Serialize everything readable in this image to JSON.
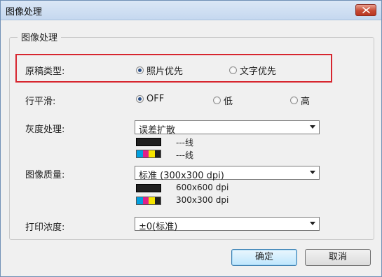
{
  "window": {
    "title": "图像处理",
    "close_icon": "close-icon"
  },
  "group": {
    "label": "图像处理"
  },
  "original_type": {
    "label": "原稿类型:",
    "options": [
      {
        "label": "照片优先",
        "checked": true
      },
      {
        "label": "文字优先",
        "checked": false
      }
    ]
  },
  "smoothing": {
    "label": "行平滑:",
    "options": [
      {
        "label": "OFF",
        "checked": true
      },
      {
        "label": "低",
        "checked": false
      },
      {
        "label": "高",
        "checked": false
      }
    ]
  },
  "grayscale": {
    "label": "灰度处理:",
    "selected": "误差扩散",
    "legend": [
      {
        "swatch": "black",
        "text": "---线"
      },
      {
        "swatch": "color",
        "text": "---线"
      }
    ]
  },
  "quality": {
    "label": "图像质量:",
    "selected": "标准 (300x300 dpi)",
    "legend": [
      {
        "swatch": "black",
        "text": "600x600 dpi"
      },
      {
        "swatch": "color",
        "text": "300x300 dpi"
      }
    ]
  },
  "density": {
    "label": "打印浓度:",
    "selected": "±0(标准)"
  },
  "buttons": {
    "ok": "确定",
    "cancel": "取消"
  },
  "colors": {
    "highlight": "#d7262f",
    "cyan": "#00a0e0",
    "magenta": "#e0208a",
    "yellow": "#f5e400",
    "black": "#202020"
  }
}
